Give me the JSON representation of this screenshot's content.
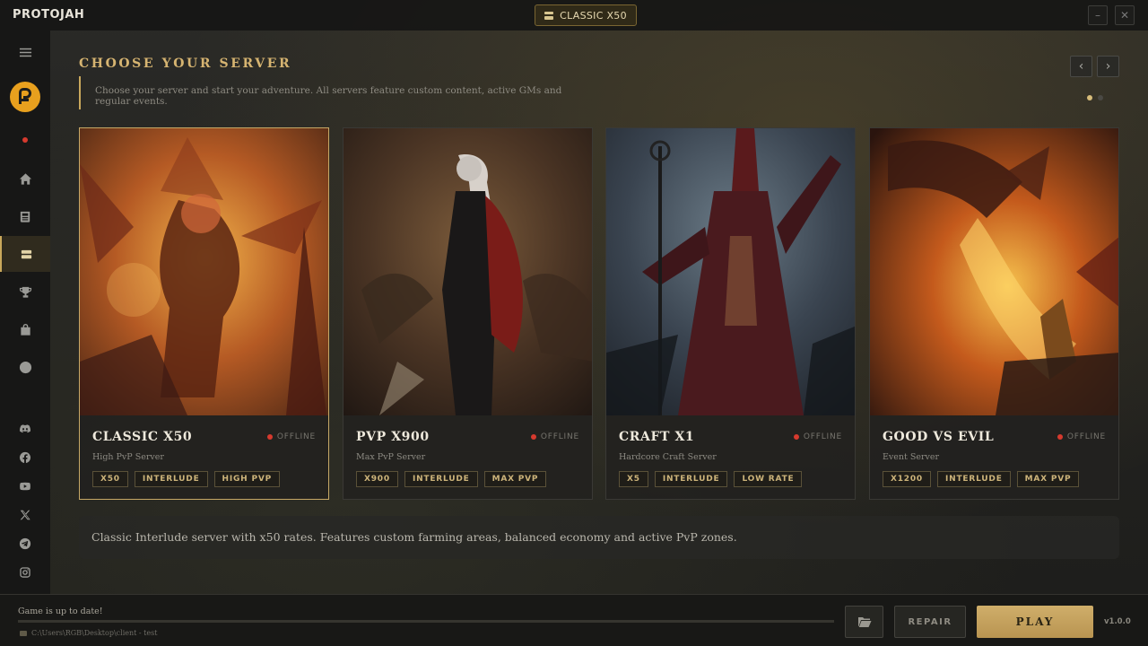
{
  "window": {
    "app_title": "PROTOJAH",
    "current_server": "CLASSIC X50",
    "minimize_label": "–",
    "close_label": "✕"
  },
  "sidebar": {
    "items": [
      {
        "name": "menu",
        "icon": "hamburger-icon"
      },
      {
        "name": "home",
        "icon": "home-icon"
      },
      {
        "name": "news",
        "icon": "newspaper-icon"
      },
      {
        "name": "servers",
        "icon": "servers-icon",
        "active": true
      },
      {
        "name": "rankings",
        "icon": "trophy-icon"
      },
      {
        "name": "shop",
        "icon": "shopping-bag-icon"
      },
      {
        "name": "website",
        "icon": "globe-icon"
      }
    ],
    "social": [
      "discord-icon",
      "facebook-icon",
      "youtube-icon",
      "x-icon",
      "telegram-icon",
      "instagram-icon"
    ]
  },
  "main": {
    "title": "CHOOSE YOUR SERVER",
    "subtitle": "Choose your server and start your adventure. All servers feature custom content, active GMs and regular events.",
    "prev_label": "‹",
    "next_label": "›",
    "selected_description": "Classic Interlude server with x50 rates. Features custom farming areas, balanced economy and active PvP zones."
  },
  "servers": [
    {
      "name": "CLASSIC X50",
      "status": "OFFLINE",
      "subtitle": "High PvP Server",
      "tags": [
        "X50",
        "INTERLUDE",
        "HIGH PVP"
      ],
      "selected": true
    },
    {
      "name": "PVP X900",
      "status": "OFFLINE",
      "subtitle": "Max PvP Server",
      "tags": [
        "X900",
        "INTERLUDE",
        "MAX PVP"
      ]
    },
    {
      "name": "CRAFT X1",
      "status": "OFFLINE",
      "subtitle": "Hardcore Craft Server",
      "tags": [
        "X5",
        "INTERLUDE",
        "LOW RATE"
      ]
    },
    {
      "name": "GOOD VS EVIL",
      "status": "OFFLINE",
      "subtitle": "Event Server",
      "tags": [
        "X1200",
        "INTERLUDE",
        "MAX PVP"
      ]
    }
  ],
  "footer": {
    "status_text": "Game is up to date!",
    "path": "C:\\Users\\RGB\\Desktop\\client - test",
    "repair_label": "REPAIR",
    "play_label": "PLAY",
    "version": "v1.0.0"
  },
  "colors": {
    "accent": "#c9a85c",
    "status_offline": "#d63a2e",
    "background": "#22221f"
  }
}
